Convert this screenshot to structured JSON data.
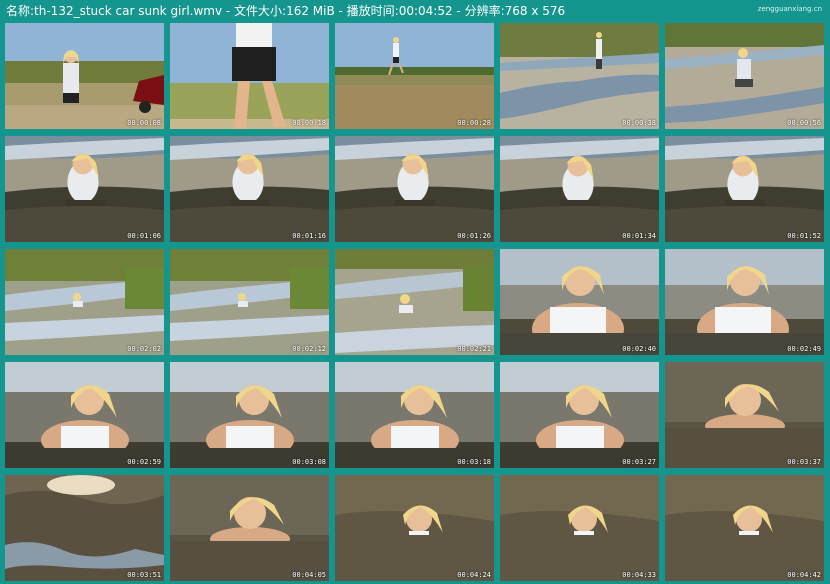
{
  "header": {
    "title": "名称:th-132_stuck car sunk girl.wmv - 文件大小:162 MiB - 播放时间:00:04:52 - 分辨率:768 x 576",
    "watermark": "zengguanxiang.cn"
  },
  "thumbnails": [
    {
      "timestamp": "00:00:08",
      "scene": "field-car"
    },
    {
      "timestamp": "00:00:18",
      "scene": "legs-walking"
    },
    {
      "timestamp": "00:00:28",
      "scene": "field-distant"
    },
    {
      "timestamp": "00:00:38",
      "scene": "creek-standing"
    },
    {
      "timestamp": "00:00:56",
      "scene": "creek-crouch"
    },
    {
      "timestamp": "00:01:06",
      "scene": "mud-waist"
    },
    {
      "timestamp": "00:01:16",
      "scene": "mud-waist"
    },
    {
      "timestamp": "00:01:26",
      "scene": "mud-waist"
    },
    {
      "timestamp": "00:01:34",
      "scene": "mud-chest"
    },
    {
      "timestamp": "00:01:52",
      "scene": "mud-chest"
    },
    {
      "timestamp": "00:02:02",
      "scene": "creek-far"
    },
    {
      "timestamp": "00:02:12",
      "scene": "creek-far"
    },
    {
      "timestamp": "00:02:21",
      "scene": "creek-mid"
    },
    {
      "timestamp": "00:02:40",
      "scene": "closeup-chest"
    },
    {
      "timestamp": "00:02:49",
      "scene": "closeup-chest"
    },
    {
      "timestamp": "00:02:59",
      "scene": "closeup-shoulders"
    },
    {
      "timestamp": "00:03:08",
      "scene": "closeup-shoulders"
    },
    {
      "timestamp": "00:03:18",
      "scene": "closeup-shoulders"
    },
    {
      "timestamp": "00:03:27",
      "scene": "closeup-shoulders"
    },
    {
      "timestamp": "00:03:37",
      "scene": "closeup-neck"
    },
    {
      "timestamp": "00:03:51",
      "scene": "mud-surface"
    },
    {
      "timestamp": "00:04:05",
      "scene": "closeup-neck"
    },
    {
      "timestamp": "00:04:24",
      "scene": "head-only"
    },
    {
      "timestamp": "00:04:33",
      "scene": "head-only"
    },
    {
      "timestamp": "00:04:42",
      "scene": "head-only"
    }
  ]
}
